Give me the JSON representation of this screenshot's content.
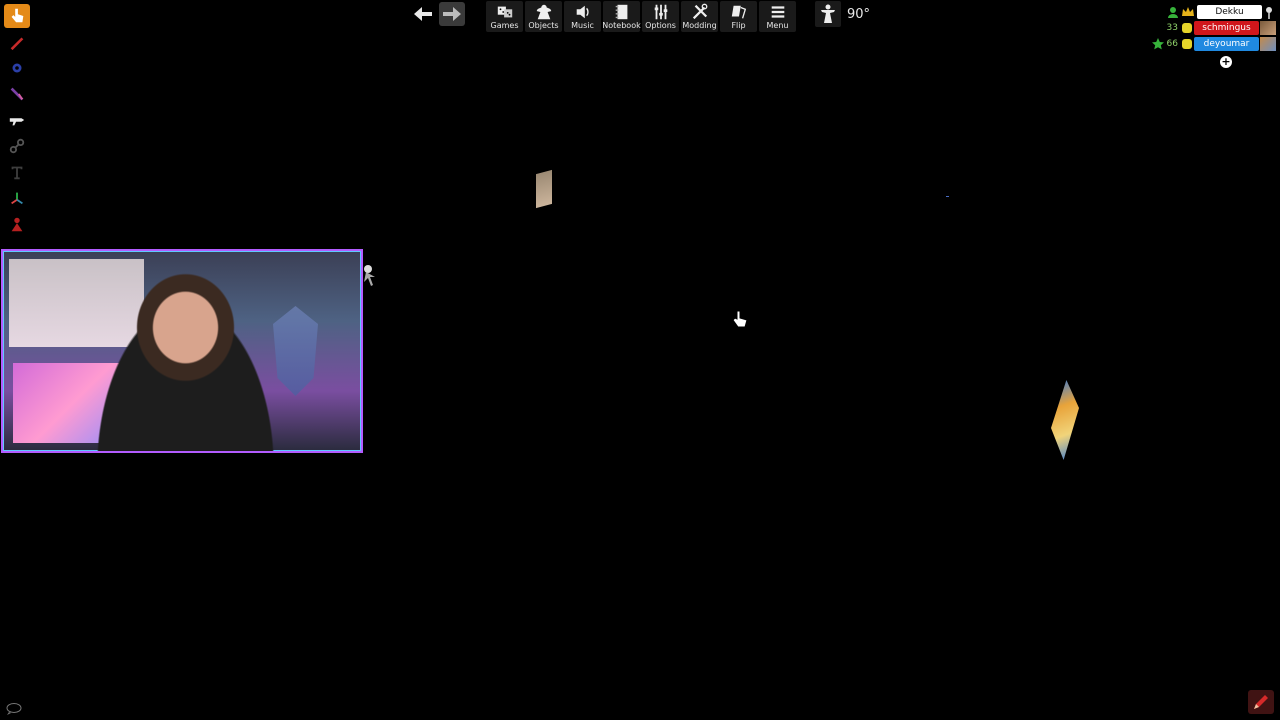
{
  "toolbar": {
    "buttons": [
      {
        "label": "Games",
        "icon": "dice-icon"
      },
      {
        "label": "Objects",
        "icon": "meeple-icon"
      },
      {
        "label": "Music",
        "icon": "speaker-icon"
      },
      {
        "label": "Notebook",
        "icon": "notebook-icon"
      },
      {
        "label": "Options",
        "icon": "sliders-icon"
      },
      {
        "label": "Modding",
        "icon": "tools-icon"
      },
      {
        "label": "Flip",
        "icon": "flip-icon"
      },
      {
        "label": "Menu",
        "icon": "hamburger-icon"
      }
    ],
    "rotation_label": "90°"
  },
  "players": {
    "rows": [
      {
        "name": "Dekku",
        "score": "",
        "color": "#ffffff",
        "text_color": "#111111"
      },
      {
        "name": "schmingus",
        "score": "33",
        "color": "#d0161b",
        "text_color": "#ffffff"
      },
      {
        "name": "deyoumar",
        "score": "66",
        "color": "#1f89e0",
        "text_color": "#ffffff"
      }
    ],
    "add_label": "+"
  },
  "colors": {
    "accent": "#e48a18",
    "background": "#000000"
  }
}
